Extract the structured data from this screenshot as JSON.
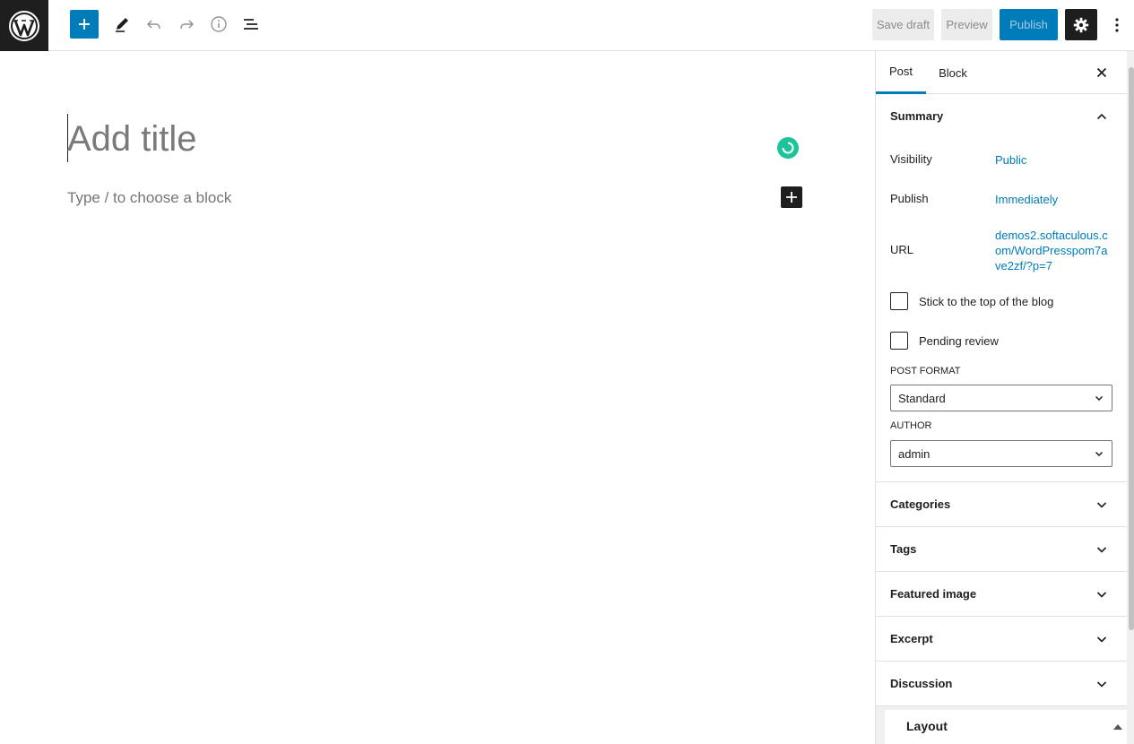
{
  "header": {
    "save_draft_label": "Save draft",
    "preview_label": "Preview",
    "publish_label": "Publish",
    "accent_color": "#007cba",
    "icons": [
      "wordpress-logo-icon",
      "plus-icon",
      "pencil-icon",
      "undo-icon",
      "redo-icon",
      "info-icon",
      "list-view-icon",
      "gear-icon",
      "more-vertical-icon"
    ]
  },
  "editor": {
    "title_placeholder": "Add title",
    "block_placeholder": "Type / to choose a block"
  },
  "sidebar": {
    "tabs": [
      {
        "label": "Post",
        "active": true
      },
      {
        "label": "Block",
        "active": false
      }
    ],
    "summary": {
      "title": "Summary",
      "visibility_label": "Visibility",
      "visibility_value": "Public",
      "publish_label": "Publish",
      "publish_value": "Immediately",
      "url_label": "URL",
      "url_value": "demos2.softaculous.com/WordPresspom7ave2zf/?p=7",
      "sticky_label": "Stick to the top of the blog",
      "pending_label": "Pending review",
      "post_format_label": "POST FORMAT",
      "post_format_value": "Standard",
      "author_label": "AUTHOR",
      "author_value": "admin"
    },
    "panels": [
      "Categories",
      "Tags",
      "Featured image",
      "Excerpt",
      "Discussion"
    ],
    "layout_label": "Layout"
  }
}
